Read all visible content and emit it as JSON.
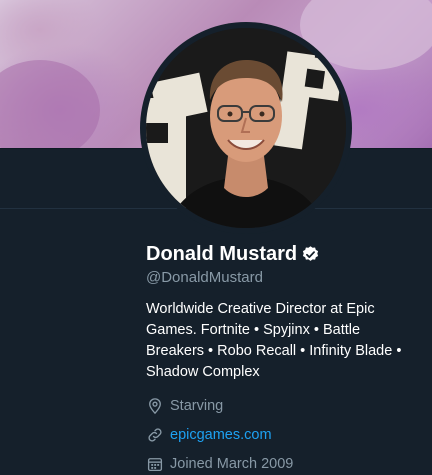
{
  "profile": {
    "name": "Donald Mustard",
    "handle": "@DonaldMustard",
    "bio": "Worldwide Creative Director at Epic Games. Fortnite • Spyjinx • Battle Breakers • Robo Recall • Infinity Blade • Shadow Complex",
    "location": "Starving",
    "website": "epicgames.com",
    "joined": "Joined March 2009"
  },
  "colors": {
    "background": "#15202b",
    "text": "#ffffff",
    "muted": "#8899a6",
    "link": "#1da1f2"
  },
  "icons": {
    "verified": "verified-badge-icon",
    "location": "location-pin-icon",
    "website": "link-icon",
    "joined": "calendar-icon"
  }
}
